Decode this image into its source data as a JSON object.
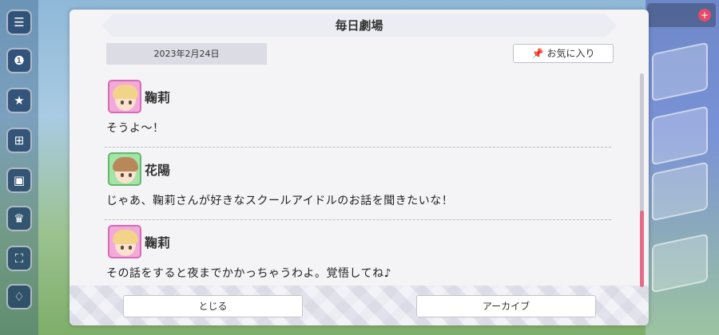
{
  "modal": {
    "title": "毎日劇場",
    "date": "2023年2月24日",
    "favorite_label": "お気に入り",
    "favorite_icon": "pin-icon"
  },
  "dialogue": [
    {
      "speaker": "鞠莉",
      "text": "そうよ～！",
      "avatar": "mari"
    },
    {
      "speaker": "花陽",
      "text": "じゃあ、鞠莉さんが好きなスクールアイドルのお話を聞きたいな！",
      "avatar": "hanayo"
    },
    {
      "speaker": "鞠莉",
      "text": "その話をすると夜までかかっちゃうわよ。覚悟してね♪",
      "avatar": "mari"
    }
  ],
  "footer": {
    "close_label": "とじる",
    "archive_label": "アーカイブ"
  },
  "colors": {
    "accent": "#e56c86",
    "mari_frame": "#f3a9d9",
    "hanayo_frame": "#a5e3a8"
  }
}
